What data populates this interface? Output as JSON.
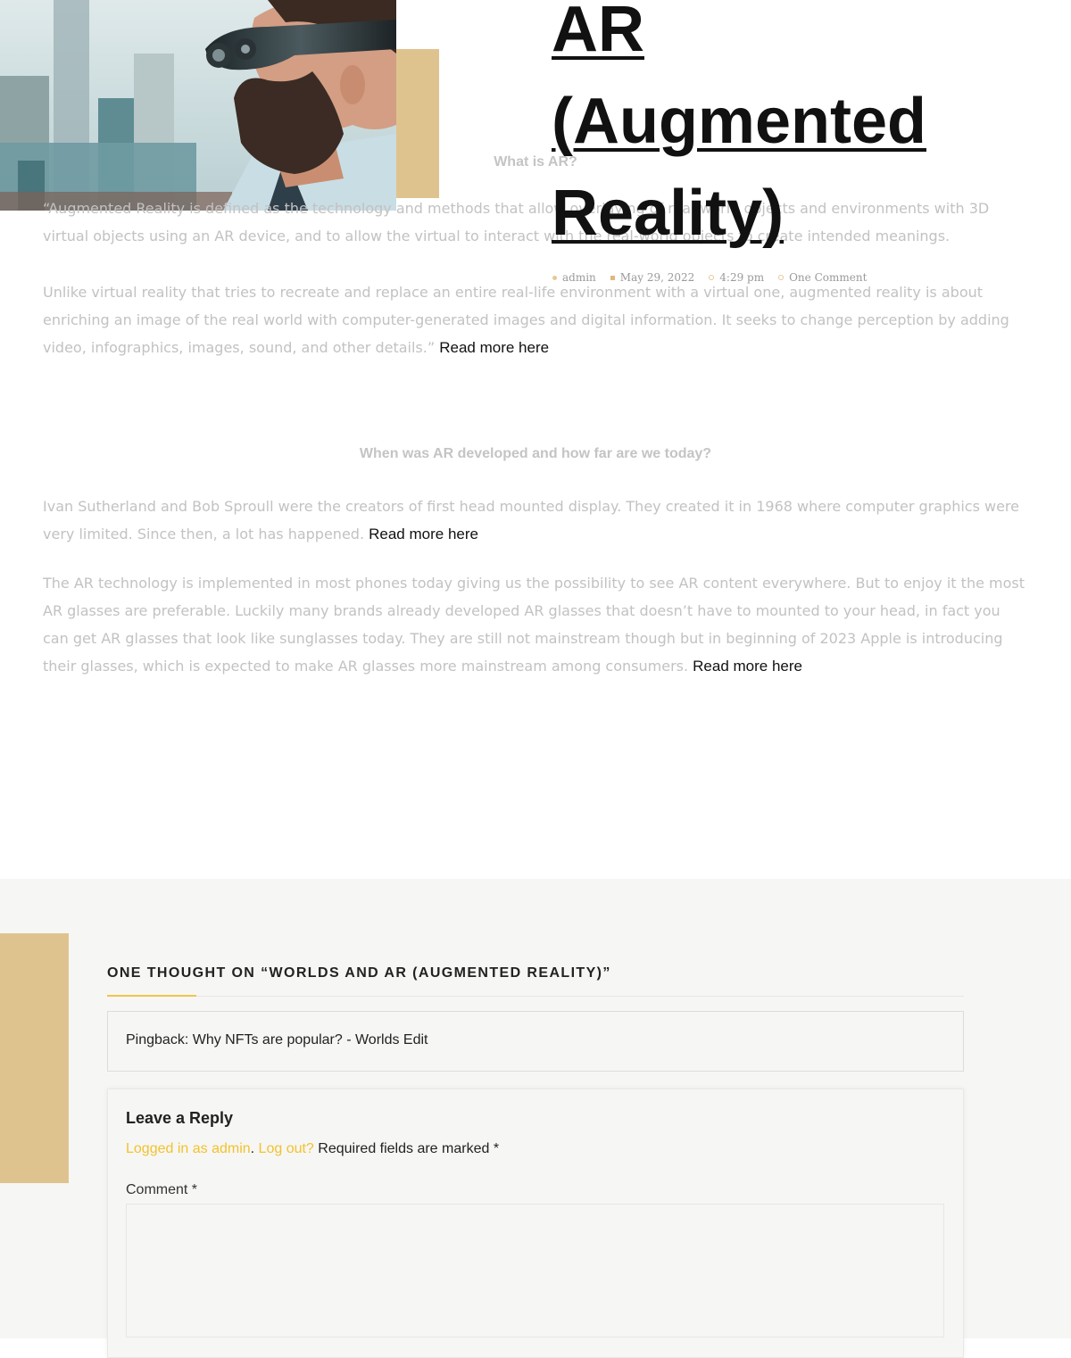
{
  "post": {
    "title_lines": [
      "AR",
      "(Augmented",
      "Reality)"
    ],
    "meta": {
      "author": "admin",
      "date": "May 29, 2022",
      "time": "4:29 pm",
      "comments": "One Comment"
    }
  },
  "content": {
    "section1_heading": "What is AR?",
    "para1": "“Augmented Reality is defined as the technology and methods that allow overlaying of real-world objects and environments with 3D virtual objects using an AR device, and to allow the virtual to interact with the real-world objects to create intended meanings.",
    "para2": "Unlike virtual reality that tries to recreate and replace an entire real-life environment with a virtual one, augmented reality is about enriching an image of the real world with computer-generated images and digital information. It seeks to change perception by adding video, infographics, images, sound, and other details.”",
    "section2_heading": "When was AR developed and how far are we today?",
    "para3": "Ivan Sutherland and Bob Sproull were the creators of first head mounted display. They created it in 1968 where computer graphics were very limited. Since then, a lot has happened.",
    "para4": "The AR technology is implemented in most phones today giving us the possibility to see AR content everywhere. But to enjoy it the most AR glasses are preferable. Luckily many brands already developed AR glasses that doesn’t have to mounted to your head, in fact you can get AR glasses that look like sunglasses today. They are still not mainstream though but in beginning of 2023 Apple is introducing their glasses, which is expected to make AR glasses more mainstream among consumers.",
    "read_more": "Read more here"
  },
  "comments": {
    "title": "ONE THOUGHT ON “WORLDS AND AR (AUGMENTED REALITY)”",
    "pingback": "Pingback: Why NFTs are popular? - Worlds Edit",
    "reply_title": "Leave a Reply",
    "logged_in_text": "Logged in as admin",
    "logout_text": "Log out?",
    "required_text": "Required fields are marked *",
    "comment_label": "Comment *",
    "comment_value": ""
  },
  "colors": {
    "accent_gold": "#dfc38f",
    "link_yellow": "#f2c22d",
    "muted_text": "#c2c2c2"
  }
}
